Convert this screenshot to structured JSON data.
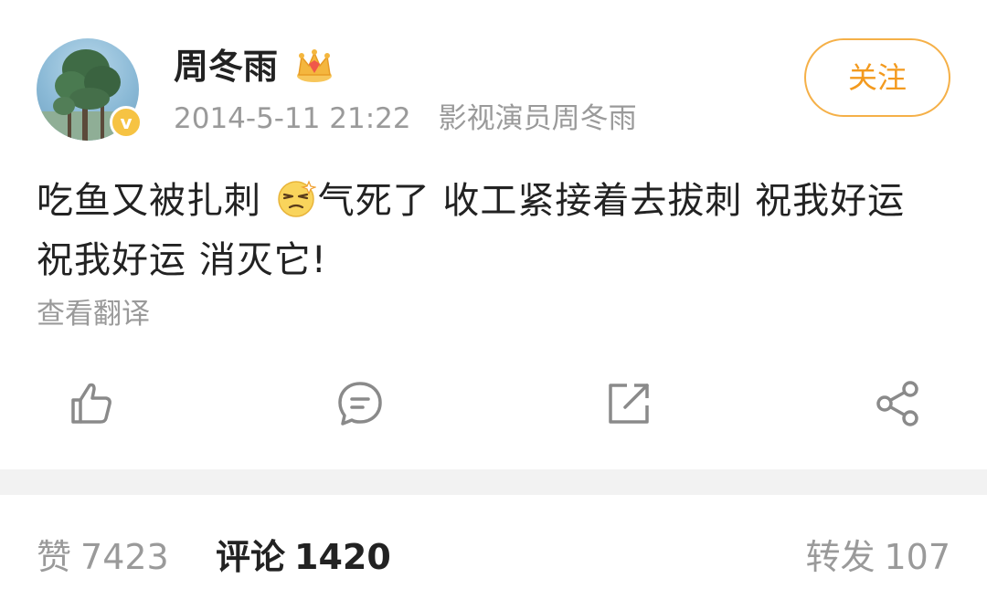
{
  "post": {
    "author": "周冬雨",
    "date": "2014-5-11 21:22",
    "source": "影视演员周冬雨",
    "follow_label": "关注",
    "text_part1": "吃鱼又被扎刺 ",
    "emoji": "dizzy-face-emoji",
    "text_part2": "气死了  收工紧接着去拔刺 祝我好运 祝我好运  消灭它!",
    "translate_label": "查看翻译"
  },
  "actions": [
    {
      "name": "like",
      "icon": "thumb-up-icon"
    },
    {
      "name": "comment",
      "icon": "comment-bubble-icon"
    },
    {
      "name": "repost",
      "icon": "share-out-icon"
    },
    {
      "name": "share",
      "icon": "share-nodes-icon"
    }
  ],
  "stats": {
    "likes_label": "赞",
    "likes_count": "7423",
    "comments_label": "评论",
    "comments_count": "1420",
    "reposts_label": "转发",
    "reposts_count": "107"
  },
  "colors": {
    "accent": "#f39a1e",
    "accent_border": "#f5b048",
    "verified_badge": "#f6c343",
    "muted_text": "#9a9a9a",
    "divider": "#f2f2f2"
  }
}
